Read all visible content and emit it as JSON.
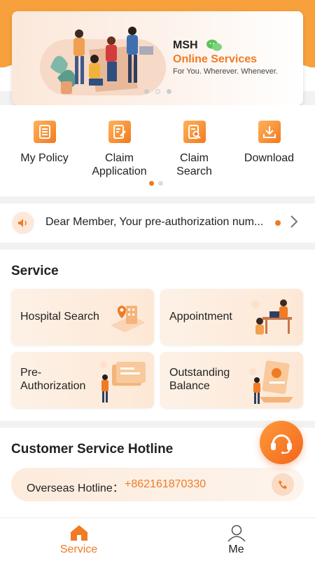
{
  "banner": {
    "title": "MSH",
    "subtitle": "Online Services",
    "tagline": "For You. Wherever. Whenever.",
    "slide_index": 2,
    "slide_count": 3
  },
  "quick_actions": [
    {
      "label": "My Policy",
      "icon": "document-list-icon"
    },
    {
      "label": "Claim\nApplication",
      "icon": "claim-form-icon"
    },
    {
      "label": "Claim\nSearch",
      "icon": "claim-search-icon"
    },
    {
      "label": "Download",
      "icon": "download-icon"
    }
  ],
  "notice": {
    "text": "Dear Member, Your pre-authorization num..."
  },
  "service": {
    "title": "Service",
    "cards": [
      {
        "label": "Hospital Search"
      },
      {
        "label": "Appointment"
      },
      {
        "label": "Pre-\nAuthorization"
      },
      {
        "label": "Outstanding\nBalance"
      }
    ]
  },
  "hotline": {
    "title": "Customer Service Hotline",
    "label": "Overseas Hotline：",
    "number": "+862161870330"
  },
  "tabs": [
    {
      "label": "Service",
      "active": true
    },
    {
      "label": "Me",
      "active": false
    }
  ],
  "colors": {
    "accent": "#f07b23",
    "header": "#f7a03c"
  }
}
